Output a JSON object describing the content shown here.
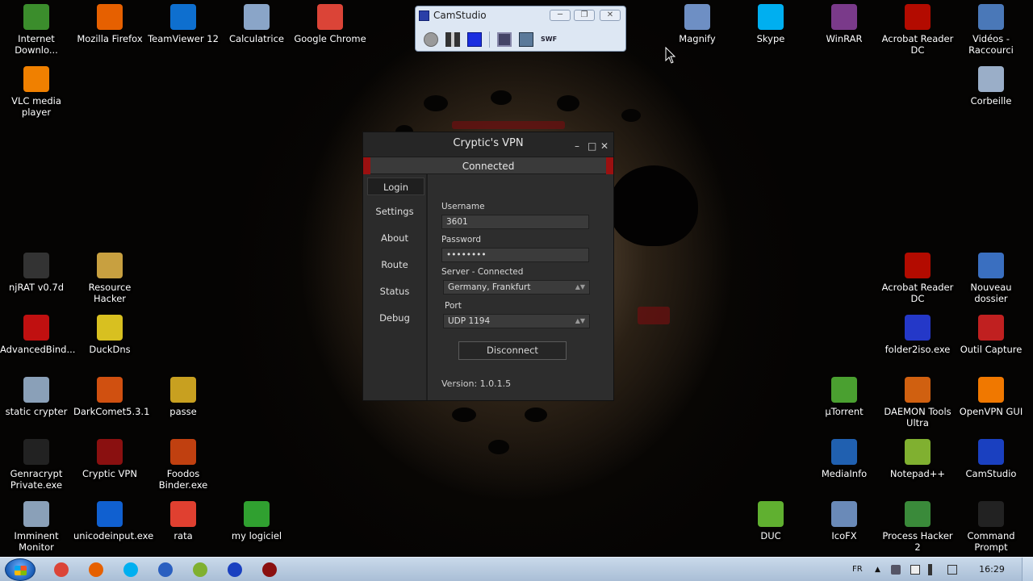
{
  "desktop": {
    "icons": [
      {
        "label": "Internet Downlo...",
        "icon": "idm-icon",
        "color": "#3b8d2c"
      },
      {
        "label": "Mozilla Firefox",
        "icon": "firefox-icon",
        "color": "#e66000"
      },
      {
        "label": "TeamViewer 12",
        "icon": "teamviewer-icon",
        "color": "#0e6fcf"
      },
      {
        "label": "Calculatrice",
        "icon": "calculator-icon",
        "color": "#8aa5c8"
      },
      {
        "label": "Google Chrome",
        "icon": "chrome-icon",
        "color": "#db4437"
      },
      {
        "label": "Magnify",
        "icon": "magnify-icon",
        "color": "#6e8fc4"
      },
      {
        "label": "Skype",
        "icon": "skype-icon",
        "color": "#00aff0"
      },
      {
        "label": "WinRAR",
        "icon": "winrar-icon",
        "color": "#7a3a8a"
      },
      {
        "label": "Acrobat Reader DC",
        "icon": "acrobat-icon",
        "color": "#b30b00"
      },
      {
        "label": "Vidéos - Raccourci",
        "icon": "videos-icon",
        "color": "#4a78b8"
      },
      {
        "label": "VLC media player",
        "icon": "vlc-icon",
        "color": "#f08000"
      },
      {
        "label": "Corbeille",
        "icon": "recycle-bin-icon",
        "color": "#9aaec8"
      },
      {
        "label": "njRAT v0.7d",
        "icon": "njrat-icon",
        "color": "#333333"
      },
      {
        "label": "Resource Hacker",
        "icon": "resource-hacker-icon",
        "color": "#c8a040"
      },
      {
        "label": "Acrobat Reader DC",
        "icon": "acrobat-icon",
        "color": "#b30b00"
      },
      {
        "label": "Nouveau dossier",
        "icon": "scissors-icon",
        "color": "#3a6fc0"
      },
      {
        "label": "AdvancedBind...",
        "icon": "biohazard-icon",
        "color": "#c01010"
      },
      {
        "label": "DuckDns",
        "icon": "duckdns-icon",
        "color": "#d8c020"
      },
      {
        "label": "folder2iso.exe",
        "icon": "folder2iso-icon",
        "color": "#2438c8"
      },
      {
        "label": "Outil Capture",
        "icon": "snipping-tool-icon",
        "color": "#c02020"
      },
      {
        "label": "static crypter",
        "icon": "syringe-icon",
        "color": "#8aa0b8"
      },
      {
        "label": "DarkComet5.3.1",
        "icon": "darkcomet-icon",
        "color": "#d05010"
      },
      {
        "label": "passe",
        "icon": "padlock-icon",
        "color": "#c8a020"
      },
      {
        "label": "µTorrent",
        "icon": "utorrent-icon",
        "color": "#4aa030"
      },
      {
        "label": "DAEMON Tools Ultra",
        "icon": "daemon-tools-icon",
        "color": "#d06010"
      },
      {
        "label": "OpenVPN GUI",
        "icon": "openvpn-icon",
        "color": "#f07800"
      },
      {
        "label": "Genracrypt Private.exe",
        "icon": "genracrypt-icon",
        "color": "#222222"
      },
      {
        "label": "Cryptic VPN",
        "icon": "cryptic-vpn-icon",
        "color": "#8a1010"
      },
      {
        "label": "Foodos Binder.exe",
        "icon": "foodos-icon",
        "color": "#c04010"
      },
      {
        "label": "MediaInfo",
        "icon": "mediainfo-icon",
        "color": "#2060b0"
      },
      {
        "label": "Notepad++",
        "icon": "notepadpp-icon",
        "color": "#80b030"
      },
      {
        "label": "CamStudio",
        "icon": "camstudio-icon",
        "color": "#1a40c0"
      },
      {
        "label": "Imminent Monitor",
        "icon": "syringe-icon",
        "color": "#8aa0b8"
      },
      {
        "label": "unicodeinput.exe",
        "icon": "info-icon",
        "color": "#1060d0"
      },
      {
        "label": "rata",
        "icon": "power-icon",
        "color": "#e04030"
      },
      {
        "label": "my logiciel",
        "icon": "green-arrow-icon",
        "color": "#30a030"
      },
      {
        "label": "DUC",
        "icon": "duc-icon",
        "color": "#60b030"
      },
      {
        "label": "IcoFX",
        "icon": "icofx-icon",
        "color": "#6a8ab8"
      },
      {
        "label": "Process Hacker 2",
        "icon": "process-hacker-icon",
        "color": "#3a8a3a"
      },
      {
        "label": "Command Prompt",
        "icon": "cmd-icon",
        "color": "#222222"
      }
    ]
  },
  "camstudio": {
    "title": "CamStudio",
    "buttons": [
      "record-icon",
      "pause-icon",
      "stop-icon",
      "options-icon",
      "region-icon",
      "swf-icon"
    ]
  },
  "vpn": {
    "title": "Cryptic's VPN",
    "status": "Connected",
    "nav": [
      "Login",
      "Settings",
      "About",
      "Route",
      "Status",
      "Debug"
    ],
    "username_label": "Username",
    "username_value": "3601",
    "password_label": "Password",
    "password_value": "••••••••",
    "server_label": "Server - Connected",
    "server_value": "Germany, Frankfurt",
    "port_label": "Port",
    "port_value": "UDP 1194",
    "disconnect_label": "Disconnect",
    "version": "Version: 1.0.1.5",
    "accent": "#9b1010"
  },
  "taskbar": {
    "apps": [
      "chrome-icon",
      "firefox-icon",
      "skype-icon",
      "malwarebytes-icon",
      "notepadpp-icon",
      "camstudio-icon",
      "cryptic-vpn-icon"
    ],
    "lang": "FR",
    "time": "16:29"
  }
}
